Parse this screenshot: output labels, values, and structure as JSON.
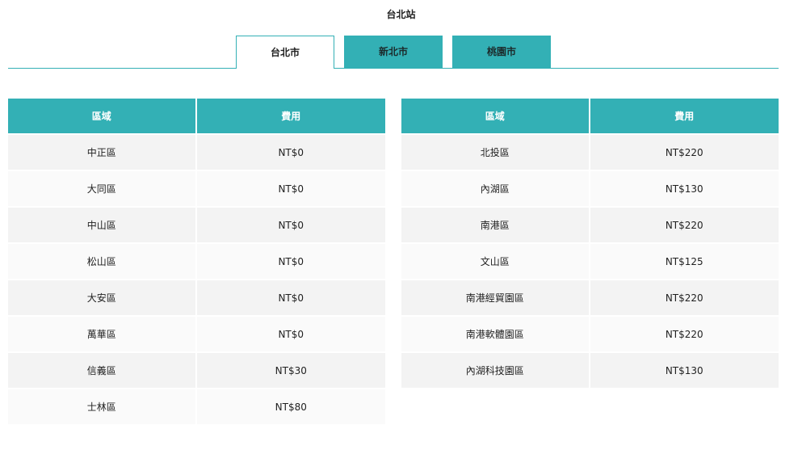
{
  "page": {
    "title": "台北站"
  },
  "tabs": [
    {
      "label": "台北市",
      "active": true
    },
    {
      "label": "新北市",
      "active": false
    },
    {
      "label": "桃園市",
      "active": false
    }
  ],
  "colors": {
    "accent": "#33b0b5",
    "row_odd": "#f3f3f3",
    "row_even": "#fafafa"
  },
  "tables": {
    "headers": {
      "area": "區域",
      "fee": "費用"
    },
    "left": [
      {
        "area": "中正區",
        "fee": "NT$0"
      },
      {
        "area": "大同區",
        "fee": "NT$0"
      },
      {
        "area": "中山區",
        "fee": "NT$0"
      },
      {
        "area": "松山區",
        "fee": "NT$0"
      },
      {
        "area": "大安區",
        "fee": "NT$0"
      },
      {
        "area": "萬華區",
        "fee": "NT$0"
      },
      {
        "area": "信義區",
        "fee": "NT$30"
      },
      {
        "area": "士林區",
        "fee": "NT$80"
      }
    ],
    "right": [
      {
        "area": "北投區",
        "fee": "NT$220"
      },
      {
        "area": "內湖區",
        "fee": "NT$130"
      },
      {
        "area": "南港區",
        "fee": "NT$220"
      },
      {
        "area": "文山區",
        "fee": "NT$125"
      },
      {
        "area": "南港經貿園區",
        "fee": "NT$220"
      },
      {
        "area": "南港軟體園區",
        "fee": "NT$220"
      },
      {
        "area": "內湖科技園區",
        "fee": "NT$130"
      }
    ]
  }
}
